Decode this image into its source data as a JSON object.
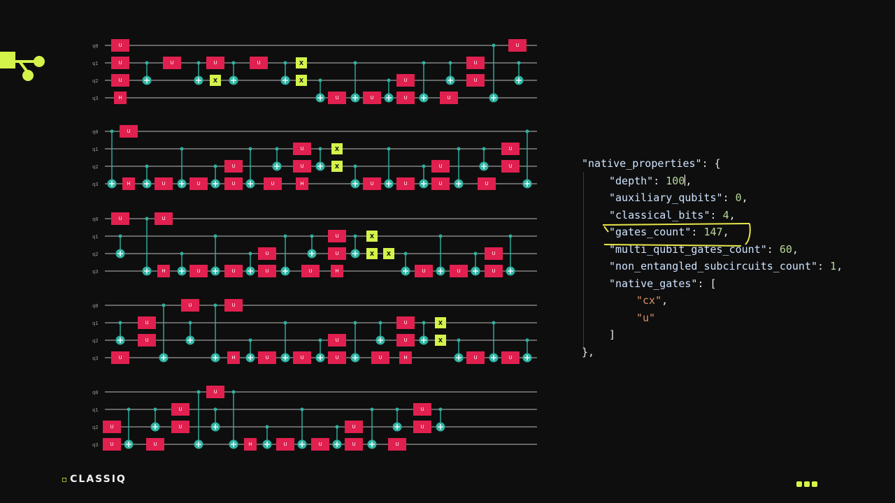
{
  "brand": {
    "name": "CLASSIQ",
    "glyph": "▫"
  },
  "colors": {
    "accent": "#d4f34a",
    "u_gate": "#e0204f",
    "x_gate": "#d4f34a",
    "cx": "#2fb3a3",
    "wire": "#bdbdbd"
  },
  "circuit": {
    "qubit_labels": [
      "q0",
      "q1",
      "q2",
      "q3"
    ],
    "u_gate_label": "U",
    "x_gate_label": "X",
    "h_gate_label": "H"
  },
  "json_view": {
    "lines": [
      {
        "key": "\"native_properties\"",
        "sep": ": ",
        "open": "{"
      },
      {
        "key": "\"depth\"",
        "sep": ": ",
        "value": "100",
        "trail": ","
      },
      {
        "key": "\"auxiliary_qubits\"",
        "sep": ": ",
        "value": "0",
        "trail": ","
      },
      {
        "key": "\"classical_bits\"",
        "sep": ": ",
        "value": "4",
        "trail": ","
      },
      {
        "key": "\"gates_count\"",
        "sep": ": ",
        "value": "147",
        "trail": ","
      },
      {
        "key": "\"multi_qubit_gates_count\"",
        "sep": ": ",
        "value": "60",
        "trail": ","
      },
      {
        "key": "\"non_entangled_subcircuits_count\"",
        "sep": ": ",
        "value": "1",
        "trail": ","
      },
      {
        "key": "\"native_gates\"",
        "sep": ": ",
        "open": "["
      },
      {
        "str": "\"cx\"",
        "trail": ","
      },
      {
        "str": "\"u\""
      },
      {
        "close": "]"
      },
      {
        "close": "},"
      }
    ]
  }
}
